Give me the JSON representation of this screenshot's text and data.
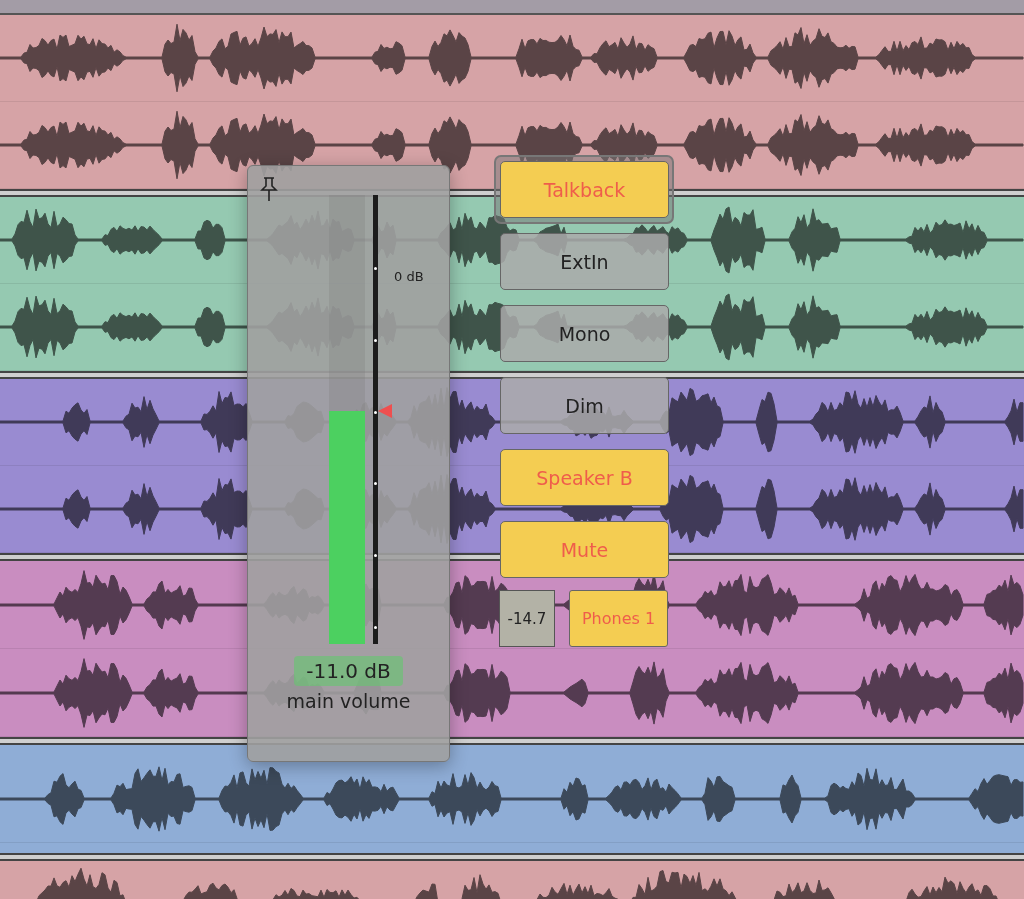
{
  "tracks": [
    {
      "color": "#d6a3a6",
      "kind": "stereo"
    },
    {
      "color": "#95c9b1",
      "kind": "stereo"
    },
    {
      "color": "#998bd1",
      "kind": "stereo"
    },
    {
      "color": "#c98dc0",
      "kind": "stereo"
    },
    {
      "color": "#8fadd6",
      "kind": "mono"
    },
    {
      "color": "#d6a3a6",
      "kind": "mono"
    }
  ],
  "volume_panel": {
    "scale_label": "0 dB",
    "fader": {
      "level": 0.52
    },
    "meter": {
      "level": 0.52
    },
    "reading": "-11.0 dB",
    "label": "main volume"
  },
  "monitor_buttons": [
    {
      "label": "Talkback",
      "kind": "toggle",
      "on": true,
      "selected": true
    },
    {
      "label": "ExtIn",
      "kind": "toggle",
      "on": false,
      "selected": false
    },
    {
      "label": "Mono",
      "kind": "toggle",
      "on": false,
      "selected": false
    },
    {
      "label": "Dim",
      "kind": "toggle",
      "on": false,
      "selected": false
    },
    {
      "label": "Speaker B",
      "kind": "toggle",
      "on": true,
      "selected": false
    },
    {
      "label": "Mute",
      "kind": "toggle",
      "on": true,
      "selected": false
    },
    {
      "label": "Phones 1",
      "kind": "output",
      "reading": "-14.7",
      "on": true,
      "selected": false
    }
  ]
}
